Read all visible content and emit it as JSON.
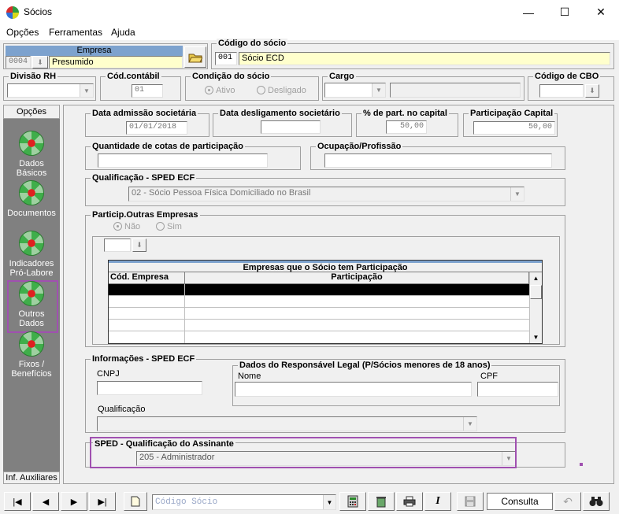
{
  "window": {
    "title": "Sócios"
  },
  "menu": {
    "items": [
      "Opções",
      "Ferramentas",
      "Ajuda"
    ]
  },
  "empresa": {
    "label": "Empresa",
    "code": "0004",
    "name": "Presumido"
  },
  "codigo_socio": {
    "label": "Código do sócio",
    "code": "001",
    "name": "Sócio ECD"
  },
  "divisao_rh": {
    "label": "Divisão RH",
    "value": ""
  },
  "cod_contabil": {
    "label": "Cód.contábil",
    "value": "01"
  },
  "condicao": {
    "label": "Condição do sócio",
    "options": [
      "Ativo",
      "Desligado"
    ],
    "selected": "Ativo"
  },
  "cargo": {
    "label": "Cargo",
    "value": ""
  },
  "cbo": {
    "label": "Código de CBO",
    "value": ""
  },
  "sidebar": {
    "header": "Opções",
    "items": [
      {
        "label": "Dados Básicos",
        "icon": "globe-icon"
      },
      {
        "label": "Documentos",
        "icon": "globe-icon"
      },
      {
        "label": "Indicadores Pró-Labore",
        "icon": "globe-icon"
      },
      {
        "label": "Outros Dados",
        "icon": "globe-icon"
      },
      {
        "label": "Fixos / Benefícios",
        "icon": "globe-icon"
      }
    ],
    "footer": "Inf. Auxiliares"
  },
  "form": {
    "data_admissao": {
      "label": "Data admissão societária",
      "value": "01/01/2018"
    },
    "data_desligamento": {
      "label": "Data desligamento societário",
      "value": ""
    },
    "perc_capital": {
      "label": "% de part. no capital",
      "value": "50,00"
    },
    "participacao_capital": {
      "label": "Participação Capital",
      "value": "50,00"
    },
    "qtd_cotas": {
      "label": "Quantidade de cotas de participação",
      "value": ""
    },
    "ocupacao": {
      "label": "Ocupação/Profissão",
      "value": ""
    },
    "qualificacao_sped": {
      "label": "Qualificação - SPED ECF",
      "value": "02 - Sócio Pessoa Física Domiciliado no Brasil"
    },
    "outras_empresas": {
      "label": "Particip.Outras Empresas",
      "options": [
        "Não",
        "Sim"
      ],
      "selected": "Não",
      "grid_title": "Empresas que o Sócio tem Participação",
      "columns": [
        "Cód. Empresa",
        "Participação"
      ]
    },
    "informacoes": {
      "label": "Informações - SPED ECF",
      "cnpj_label": "CNPJ",
      "cnpj": "",
      "qualificacao_label": "Qualificação",
      "qualificacao": "",
      "responsavel": {
        "label": "Dados do Responsável Legal (P/Sócios menores de 18 anos)",
        "nome_label": "Nome",
        "cpf_label": "CPF"
      }
    },
    "assinante": {
      "label": "SPED - Qualificação do Assinante",
      "value": "205 - Administrador"
    }
  },
  "toolbar": {
    "search_placeholder": "Código Sócio",
    "mode": "Consulta"
  }
}
